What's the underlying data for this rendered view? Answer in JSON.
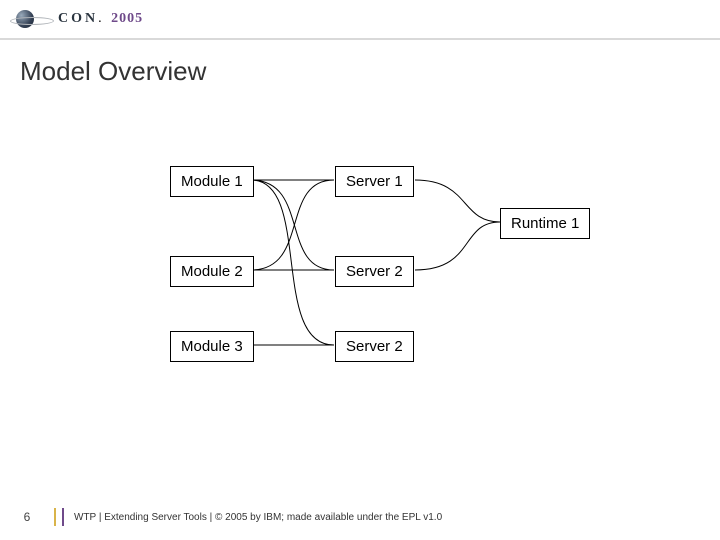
{
  "logo": {
    "con": "CON",
    "year": "2005"
  },
  "title": "Model Overview",
  "boxes": {
    "module1": "Module 1",
    "module2": "Module 2",
    "module3": "Module 3",
    "server1": "Server 1",
    "server2a": "Server 2",
    "server2b": "Server 2",
    "runtime1": "Runtime 1"
  },
  "footer": {
    "page": "6",
    "text": "WTP  |  Extending Server Tools  |  © 2005 by IBM; made available under the EPL v1.0"
  }
}
